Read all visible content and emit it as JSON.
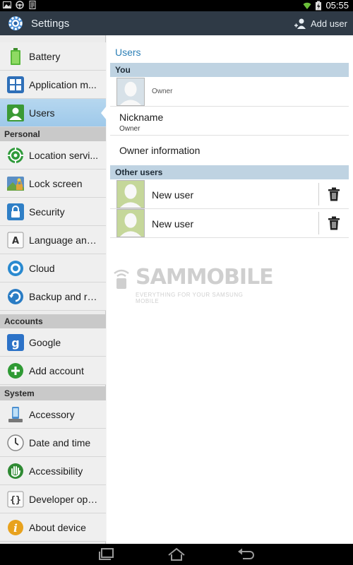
{
  "status_bar": {
    "time": "05:55",
    "left_icons": [
      "image-icon",
      "steering-wheel-icon",
      "document-icon"
    ],
    "right_icons": [
      "wifi-icon",
      "battery-charging-icon"
    ]
  },
  "action_bar": {
    "title": "Settings",
    "add_user_label": "Add user",
    "bg_color": "#2f3a46"
  },
  "sidebar": {
    "items_top": [
      {
        "label": "Battery",
        "icon": "battery-icon"
      },
      {
        "label": "Application m...",
        "icon": "application-manager-icon"
      },
      {
        "label": "Users",
        "icon": "users-icon",
        "active": true
      }
    ],
    "sections": [
      {
        "header": "Personal",
        "items": [
          {
            "label": "Location servi...",
            "icon": "location-icon"
          },
          {
            "label": "Lock screen",
            "icon": "lock-screen-icon"
          },
          {
            "label": "Security",
            "icon": "security-lock-icon"
          },
          {
            "label": "Language and...",
            "icon": "language-icon"
          },
          {
            "label": "Cloud",
            "icon": "cloud-icon"
          },
          {
            "label": "Backup and re...",
            "icon": "backup-icon"
          }
        ]
      },
      {
        "header": "Accounts",
        "items": [
          {
            "label": "Google",
            "icon": "google-icon"
          },
          {
            "label": "Add account",
            "icon": "add-account-icon"
          }
        ]
      },
      {
        "header": "System",
        "items": [
          {
            "label": "Accessory",
            "icon": "accessory-icon"
          },
          {
            "label": "Date and time",
            "icon": "clock-icon"
          },
          {
            "label": "Accessibility",
            "icon": "accessibility-hand-icon"
          },
          {
            "label": "Developer opti...",
            "icon": "developer-braces-icon"
          },
          {
            "label": "About device",
            "icon": "info-icon"
          }
        ]
      }
    ]
  },
  "main": {
    "title": "Users",
    "you_header": "You",
    "owner_label": "Owner",
    "nickname_title": "Nickname",
    "nickname_value": "Owner",
    "owner_information": "Owner information",
    "other_users_header": "Other users",
    "other_users": [
      {
        "name": "New user"
      },
      {
        "name": "New user"
      }
    ]
  },
  "watermark": {
    "logo": "SAMMOBILE",
    "tagline": "EVERYTHING FOR YOUR SAMSUNG MOBILE"
  },
  "colors": {
    "accent": "#2b7fb6",
    "section_header": "#bfd3e2",
    "active_item": "#a9d0ec"
  }
}
